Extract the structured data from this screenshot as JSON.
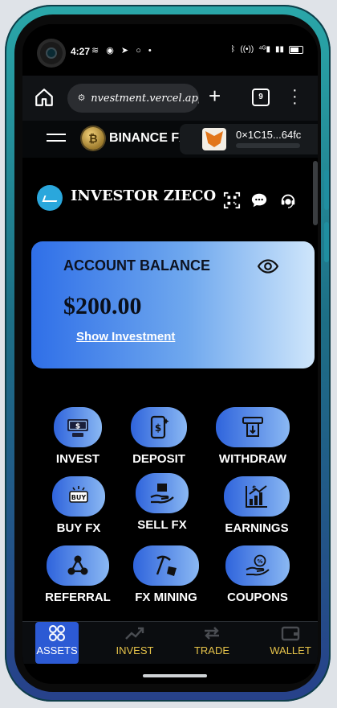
{
  "status": {
    "time": "4:27",
    "left_icons": "≋ ◉ ➤ ○ •",
    "right_icons": [
      "bluetooth-icon",
      "nfc-icon",
      "signal-4g-icon",
      "signal-icon",
      "battery-icon"
    ]
  },
  "browser": {
    "url": "nvestment.vercel.app",
    "tabs_count": "9"
  },
  "header": {
    "brand": "BINANCE FX",
    "coin_symbol": "₿",
    "wallet_address": "0×1C15...64fc"
  },
  "investor": {
    "name": "INVESTOR ZIECO"
  },
  "balance": {
    "title": "ACCOUNT BALANCE",
    "amount": "$200.00",
    "show_investment": "Show Investment"
  },
  "actions": [
    {
      "label": "INVEST",
      "icon": "cash-icon"
    },
    {
      "label": "DEPOSIT",
      "icon": "phone-dollar-icon"
    },
    {
      "label": "WITHDRAW",
      "icon": "atm-icon"
    },
    {
      "label": "BUY FX",
      "icon": "buy-tag-icon"
    },
    {
      "label": "SELL FX",
      "icon": "hand-box-icon"
    },
    {
      "label": "EARNINGS",
      "icon": "growth-chart-icon"
    },
    {
      "label": "REFERRAL",
      "icon": "network-icon"
    },
    {
      "label": "FX MINING",
      "icon": "pickaxe-icon"
    },
    {
      "label": "COUPONS",
      "icon": "hand-coupon-icon"
    }
  ],
  "bottom_nav": [
    {
      "label": "ASSETS",
      "icon": "grid-circles-icon",
      "active": true
    },
    {
      "label": "INVEST",
      "icon": "trend-up-icon",
      "active": false
    },
    {
      "label": "TRADE",
      "icon": "swap-arrows-icon",
      "active": false
    },
    {
      "label": "WALLET",
      "icon": "wallet-icon",
      "active": false
    }
  ],
  "colors": {
    "accent_blue": "#2c5ad4",
    "nav_inactive_label": "#e6c34a",
    "phone_frame": "#2aa7a9"
  }
}
